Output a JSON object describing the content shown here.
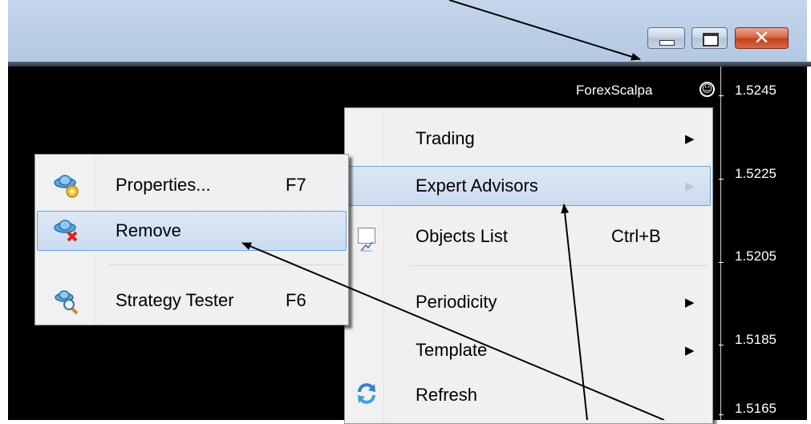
{
  "chart": {
    "ea_name": "ForexScalpa",
    "prices": [
      "1.5245",
      "1.5225",
      "1.5205",
      "1.5185",
      "1.5165"
    ]
  },
  "context_menu": {
    "items": [
      {
        "label": "Trading",
        "submenu": true
      },
      {
        "label": "Expert Advisors",
        "submenu": true,
        "highlighted": true
      },
      {
        "label": "Objects List",
        "shortcut": "Ctrl+B",
        "icon": "objects-list-icon"
      },
      {
        "label": "Periodicity",
        "submenu": true
      },
      {
        "label": "Template",
        "submenu": true
      },
      {
        "label": "Refresh",
        "icon": "refresh-icon"
      }
    ]
  },
  "submenu": {
    "items": [
      {
        "label": "Properties...",
        "shortcut": "F7",
        "icon": "expert-properties-icon"
      },
      {
        "label": "Remove",
        "shortcut": "",
        "icon": "expert-remove-icon",
        "highlighted": true
      },
      {
        "label": "Strategy Tester",
        "shortcut": "F6",
        "icon": "strategy-tester-icon"
      }
    ]
  },
  "colors": {
    "chart_background": "#000000",
    "menu_background": "#f0f0f0",
    "highlight_border": "#6fa3dd",
    "close_button": "#c2401c"
  }
}
